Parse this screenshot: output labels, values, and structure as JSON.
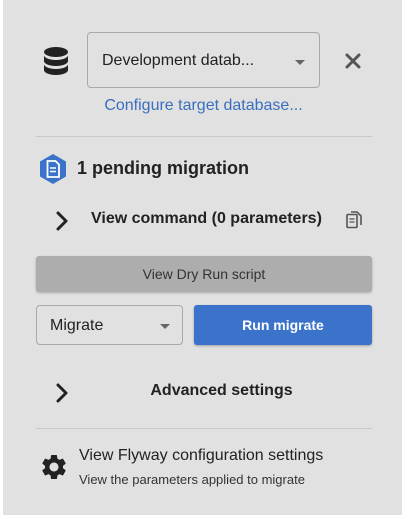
{
  "target": {
    "database_selected": "Development datab...",
    "configure_link": "Configure target database..."
  },
  "migration": {
    "pending_title": "1 pending migration",
    "view_command_label": "View command (0 parameters)",
    "dry_run_label": "View Dry Run script",
    "command_selected": "Migrate",
    "run_label": "Run migrate",
    "advanced_label": "Advanced settings"
  },
  "config": {
    "title": "View Flyway configuration settings",
    "subtitle": "View the parameters applied to migrate"
  },
  "icons": {
    "database": "database-icon",
    "close": "close-icon",
    "migration": "document-badge-icon",
    "chevron": "chevron-right-icon",
    "copy": "copy-icon",
    "settings": "gear-icon"
  },
  "colors": {
    "panel_bg": "#e1e1e1",
    "link": "#3a6fbf",
    "primary_button": "#3a73c9",
    "secondary_button": "#adadad",
    "migration_badge": "#3a73c9"
  }
}
